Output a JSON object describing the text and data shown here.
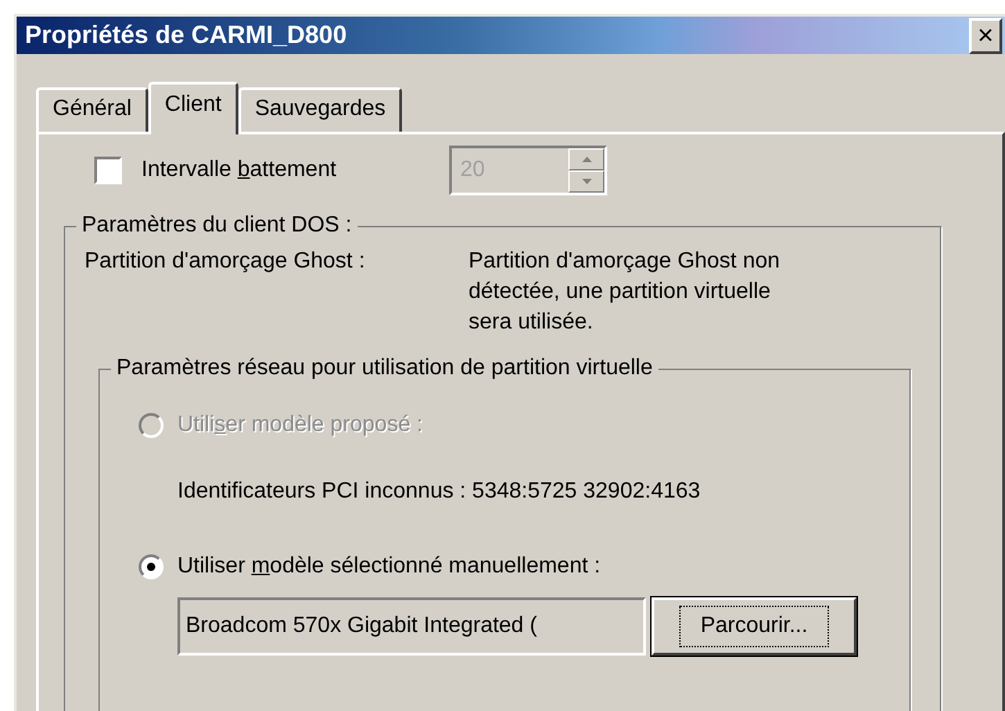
{
  "window": {
    "title": "Propriétés de CARMI_D800",
    "close": "×"
  },
  "tabs": [
    {
      "label": "Général",
      "selected": false
    },
    {
      "label": "Client",
      "selected": true
    },
    {
      "label": "Sauvegardes",
      "selected": false
    }
  ],
  "heartbeat": {
    "label": [
      "Intervalle ",
      "b",
      "attement"
    ],
    "checked": false,
    "value": "20",
    "disabled": true
  },
  "dos_group": {
    "title": "Paramètres du client DOS :",
    "partition_label": "Partition d'amorçage Ghost :",
    "partition_value": "Partition d'amorçage Ghost non détectée, une partition virtuelle sera utilisée.",
    "network_group": {
      "title": "Paramètres réseau pour utilisation de partition virtuelle",
      "options": [
        {
          "label": [
            "Utili",
            "s",
            "er modèle proposé :"
          ],
          "selected": false,
          "disabled": true
        },
        {
          "label": [
            "Utiliser ",
            "m",
            "odèle sélectionné manuellement :"
          ],
          "selected": true,
          "disabled": false
        }
      ],
      "pci_ids": "Identificateurs PCI inconnus : 5348:5725 32902:4163",
      "model_value": "Broadcom 570x Gigabit Integrated (",
      "browse_button": "Parcourir..."
    }
  }
}
